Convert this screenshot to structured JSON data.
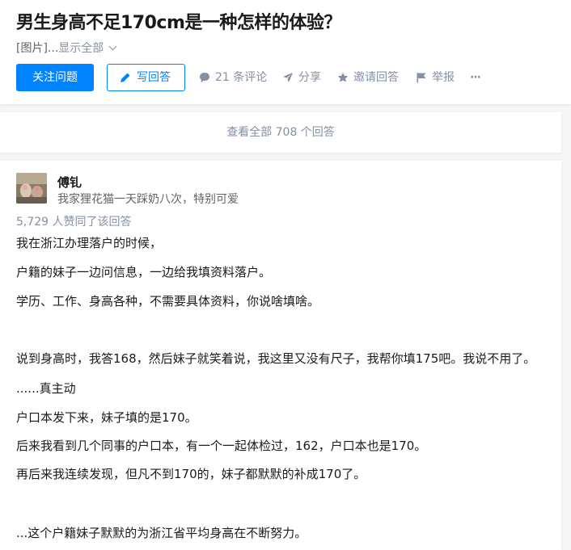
{
  "question": {
    "title": "男生身高不足170cm是一种怎样的体验？",
    "excerpt_prefix": "[图片]...",
    "show_all": "显示全部"
  },
  "actions": {
    "follow": "关注问题",
    "write": "写回答",
    "comments": "21 条评论",
    "share": "分享",
    "invite": "邀请回答",
    "report": "举报",
    "more": "···"
  },
  "view_all": "查看全部 708 个回答",
  "answer": {
    "author": "傅钆",
    "bio": "我家狸花猫一天踩奶八次，特别可爱",
    "votes": "5,729 人赞同了该回答",
    "paragraphs": [
      "我在浙江办理落户的时候，",
      "户籍的妹子一边问信息，一边给我填资料落户。",
      "学历、工作、身高各种，不需要具体资料，你说啥填啥。",
      "说到身高时，我答168，然后妹子就笑着说，我这里又没有尺子，我帮你填175吧。我说不用了。",
      "......真主动",
      "户口本发下来，妹子填的是170。",
      "后来我看到几个同事的户口本，有一个一起体检过，162，户口本也是170。",
      "再后来我连续发现，但凡不到170的，妹子都默默的补成170了。",
      "...这个户籍妹子默默的为浙江省平均身高在不断努力。"
    ]
  },
  "colors": {
    "brand_blue": "#0084ff",
    "meta_gray": "#8590a6",
    "text": "#1a1a1a",
    "page_bg": "#f6f6f6"
  },
  "icons": [
    "chevron-down-icon",
    "pen-icon",
    "comment-icon",
    "share-icon",
    "star-icon",
    "flag-icon",
    "more-icon"
  ]
}
